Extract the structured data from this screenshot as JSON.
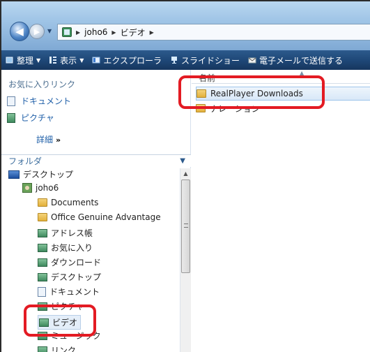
{
  "address": {
    "crumbs": [
      "joho6",
      "ビデオ"
    ]
  },
  "toolbar": {
    "organize": "整理",
    "views": "表示",
    "explorer": "エクスプローラ",
    "slideshow": "スライドショー",
    "email": "電子メールで送信する"
  },
  "nav": {
    "favorites_header": "お気に入りリンク",
    "favorites": [
      "ドキュメント",
      "ピクチャ"
    ],
    "details_label": "詳細",
    "folders_header": "フォルダ"
  },
  "tree": [
    {
      "label": "デスクトップ",
      "icon": "desktop-icon"
    },
    {
      "label": "joho6",
      "icon": "user-folder-icon"
    },
    {
      "label": "Documents",
      "icon": "folder-icon"
    },
    {
      "label": "Office Genuine Advantage",
      "icon": "folder-icon"
    },
    {
      "label": "アドレス帳",
      "icon": "contacts-icon"
    },
    {
      "label": "お気に入り",
      "icon": "favorites-icon"
    },
    {
      "label": "ダウンロード",
      "icon": "downloads-icon"
    },
    {
      "label": "デスクトップ",
      "icon": "desktop-folder-icon"
    },
    {
      "label": "ドキュメント",
      "icon": "documents-icon"
    },
    {
      "label": "ピクチャ",
      "icon": "pictures-icon"
    },
    {
      "label": "ビデオ",
      "icon": "videos-icon"
    },
    {
      "label": "ミュージック",
      "icon": "music-icon"
    },
    {
      "label": "リンク",
      "icon": "links-icon"
    }
  ],
  "content": {
    "column_name": "名前",
    "files": [
      "RealPlayer Downloads",
      "ナレーション"
    ]
  },
  "colors": {
    "toolbar": "#1f4878",
    "annotation": "#e31b23",
    "link": "#1f5fa8"
  }
}
